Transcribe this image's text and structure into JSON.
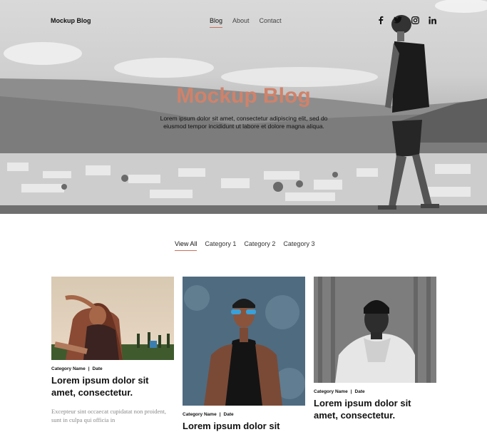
{
  "header": {
    "brand": "Mockup Blog",
    "nav": [
      {
        "label": "Blog",
        "active": true
      },
      {
        "label": "About",
        "active": false
      },
      {
        "label": "Contact",
        "active": false
      }
    ],
    "social_icons": [
      "facebook-icon",
      "twitter-icon",
      "instagram-icon",
      "linkedin-icon"
    ]
  },
  "hero": {
    "title": "Mockup Blog",
    "subtitle": "Lorem ipsum dolor sit amet, consectetur adipiscing elit, sed do eiusmod tempor incididunt ut labore et dolore magna aliqua."
  },
  "filters": [
    {
      "label": "View All",
      "active": true
    },
    {
      "label": "Category 1",
      "active": false
    },
    {
      "label": "Category 2",
      "active": false
    },
    {
      "label": "Category 3",
      "active": false
    }
  ],
  "posts": [
    {
      "category": "Category Name",
      "date": "Date",
      "title": "Lorem ipsum dolor sit amet, consectetur.",
      "excerpt": "Excepteur sint occaecat cupidatat non proident, sunt in culpa qui officia in"
    },
    {
      "category": "Category Name",
      "date": "Date",
      "title": "Lorem ipsum dolor sit"
    },
    {
      "category": "Category Name",
      "date": "Date",
      "title": "Lorem ipsum dolor sit amet, consectetur."
    }
  ],
  "colors": {
    "accent": "#c9715a",
    "hero_title": "#d0826a",
    "text": "#111111",
    "muted": "#8a8a8a"
  }
}
